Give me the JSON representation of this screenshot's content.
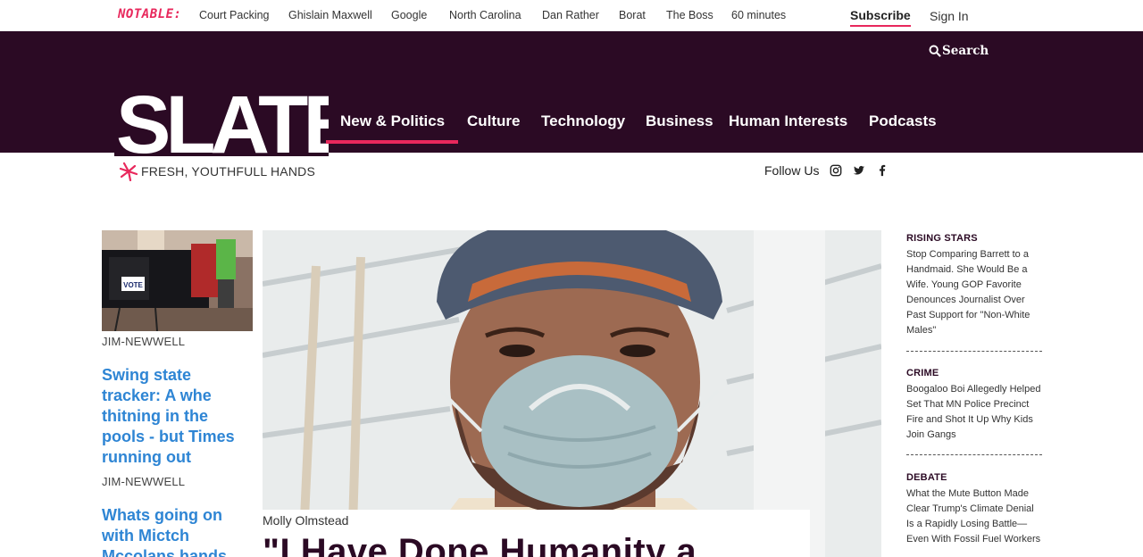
{
  "topbar": {
    "notable_label": "NOTABLE:",
    "trending": [
      "Court Packing",
      "Ghislain Maxwell",
      "Google",
      "North Carolina",
      "Dan Rather",
      "Borat",
      "The Boss",
      "60 minutes"
    ],
    "subscribe_label": "Subscribe",
    "signin_label": "Sign In"
  },
  "header": {
    "search_label": "Search",
    "logo_text": "SLATE",
    "nav": [
      "New & Politics",
      "Culture",
      "Technology",
      "Business",
      "Human Interests",
      "Podcasts"
    ],
    "active_nav": "New & Politics"
  },
  "subheader": {
    "tagline": "FRESH, YOUTHFULL HANDS",
    "follow_label": "Follow Us",
    "social_icons": [
      "instagram-icon",
      "twitter-icon",
      "facebook-icon"
    ]
  },
  "left_column": {
    "items": [
      {
        "byline": "JIM-NEWWELL"
      },
      {
        "headline": "Swing state tracker: A whe thitning in the pools - but Times running out",
        "byline": "JIM-NEWWELL"
      },
      {
        "headline": "Whats going on with Mictch Mccolans hands"
      }
    ],
    "thumb_label": "VOTE"
  },
  "hero": {
    "author": "Molly Olmstead",
    "title": "\"I Have Done Humanity a"
  },
  "right_column": {
    "items": [
      {
        "category": "RISING STARS",
        "text": "Stop Comparing Barrett to a Handmaid. She Would Be a Wife. Young GOP Favorite Denounces Journalist Over Past Support for \"Non-White Males\""
      },
      {
        "category": "CRIME",
        "text": "Boogaloo Boi Allegedly Helped Set That MN Police Precinct Fire and Shot It Up Why Kids Join Gangs"
      },
      {
        "category": "DEBATE",
        "text": "What the Mute Button Made Clear Trump's Climate Denial Is a Rapidly Losing Battle—Even With Fossil Fuel Workers"
      }
    ]
  },
  "colors": {
    "brand_dark": "#2b0a24",
    "accent_pink": "#e8285c",
    "link_blue": "#2e85d4"
  }
}
